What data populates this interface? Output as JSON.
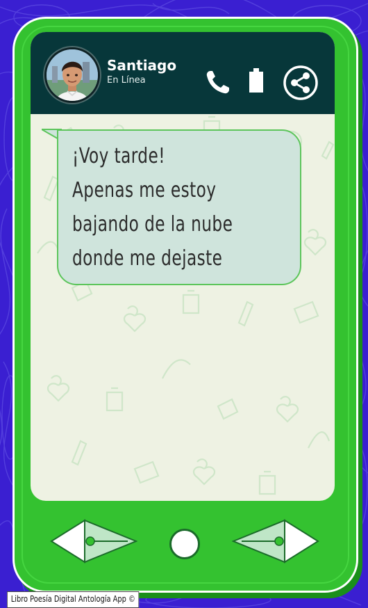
{
  "contact": {
    "name": "Santiago",
    "status": "En Línea"
  },
  "message": {
    "lines": [
      "¡Voy tarde!",
      "Apenas me estoy",
      "bajando de la nube",
      "donde me dejaste"
    ]
  },
  "icons": {
    "call": "phone-icon",
    "battery": "battery-icon",
    "share": "share-icon",
    "back": "arrow-left-icon",
    "home": "home-circle-icon",
    "forward": "arrow-right-icon"
  },
  "colors": {
    "background": "#3a1fd1",
    "phone": "#34c230",
    "header": "#07373a",
    "screen": "#eef2e3",
    "bubble": "#cfe4dc"
  },
  "footer": {
    "credit": "Libro Poesía Digital Antología App ©"
  }
}
